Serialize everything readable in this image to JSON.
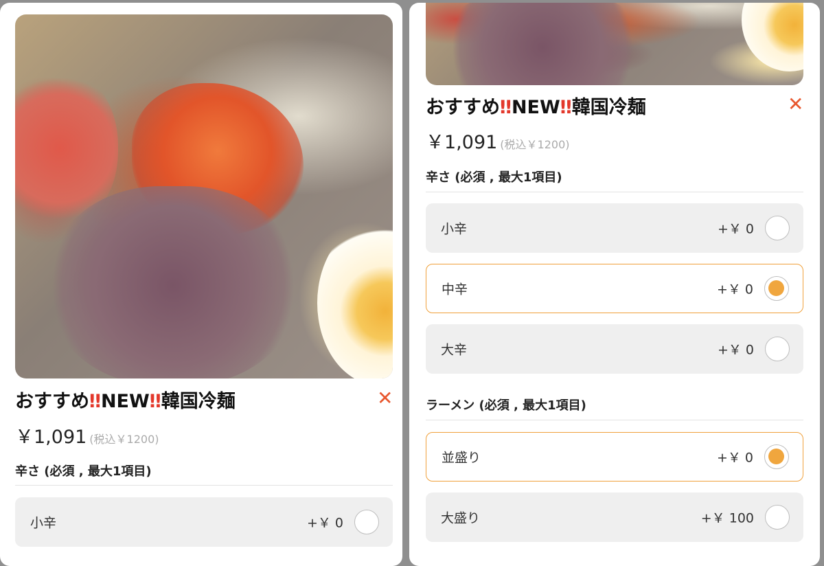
{
  "left": {
    "title_part1": "おすすめ",
    "bang1": "‼",
    "title_part2": "NEW",
    "bang2": "‼",
    "title_part3": "韓国冷麺",
    "close": "✕",
    "price": "￥1,091",
    "tax": "(税込￥1200)",
    "section1": "辛さ (必須 , 最大1項目)",
    "options": [
      {
        "label": "小辛",
        "price": "+￥ 0",
        "selected": false
      }
    ]
  },
  "right": {
    "title_part1": "おすすめ",
    "bang1": "‼",
    "title_part2": "NEW",
    "bang2": "‼",
    "title_part3": "韓国冷麺",
    "close": "✕",
    "price": "￥1,091",
    "tax": "(税込￥1200)",
    "section1": "辛さ (必須 , 最大1項目)",
    "section1_options": [
      {
        "label": "小辛",
        "price": "+￥ 0",
        "selected": false
      },
      {
        "label": "中辛",
        "price": "+￥ 0",
        "selected": true
      },
      {
        "label": "大辛",
        "price": "+￥ 0",
        "selected": false
      }
    ],
    "section2": "ラーメン (必須 , 最大1項目)",
    "section2_options": [
      {
        "label": "並盛り",
        "price": "+￥ 0",
        "selected": true
      },
      {
        "label": "大盛り",
        "price": "+￥ 100",
        "selected": false
      }
    ]
  },
  "colors": {
    "accent": "#f0a63e",
    "close": "#e8572e",
    "bang": "#e3382b",
    "option_bg": "#efefef"
  }
}
